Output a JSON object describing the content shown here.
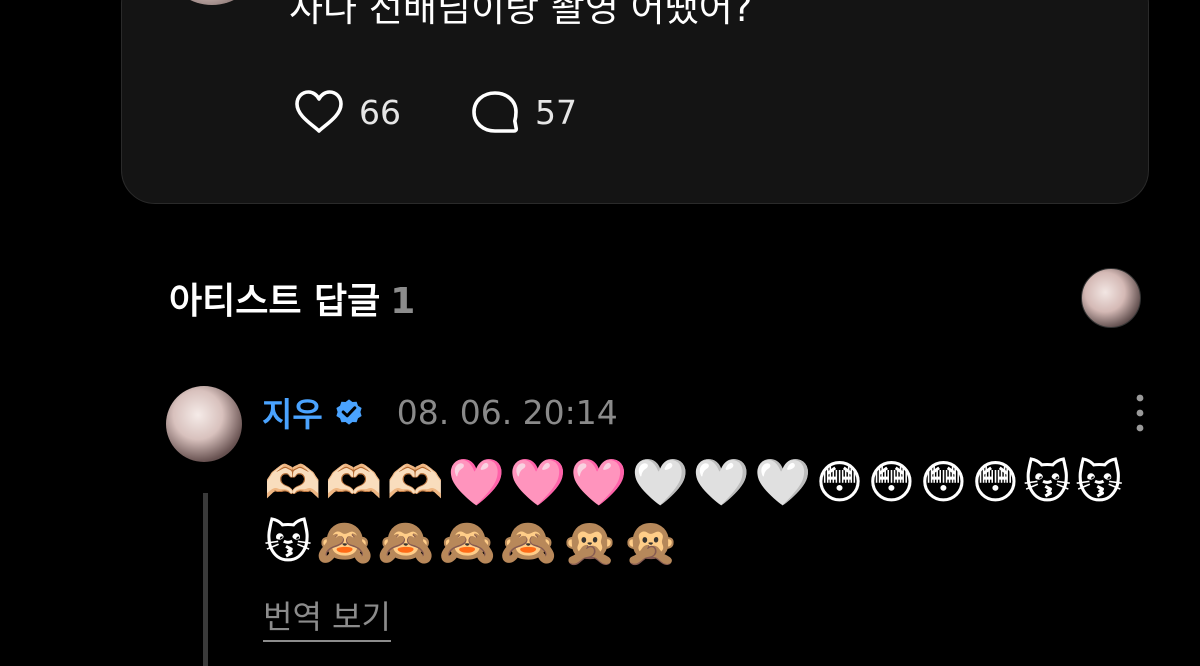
{
  "post": {
    "text": "사나 선배님이랑 촬영 어땠어?",
    "likes": "66",
    "comments": "57"
  },
  "artist_replies": {
    "title": "아티스트 답글",
    "count": "1"
  },
  "reply": {
    "author": "지우",
    "verified": true,
    "timestamp": "08. 06. 20:14",
    "text": "🫶🏻🫶🏻🫶🏻🩷🩷🩷🤍🤍🤍😳😳😳😳😽😽😽🙈🙈🙈🙈🙊🙊",
    "translate_label": "번역 보기"
  },
  "colors": {
    "background": "#000000",
    "card": "#141414",
    "accent": "#4aa3ff",
    "muted": "#8c8c8c"
  },
  "icons": [
    "heart-outline-icon",
    "comment-bubble-icon",
    "verified-badge-icon",
    "more-vertical-icon"
  ]
}
